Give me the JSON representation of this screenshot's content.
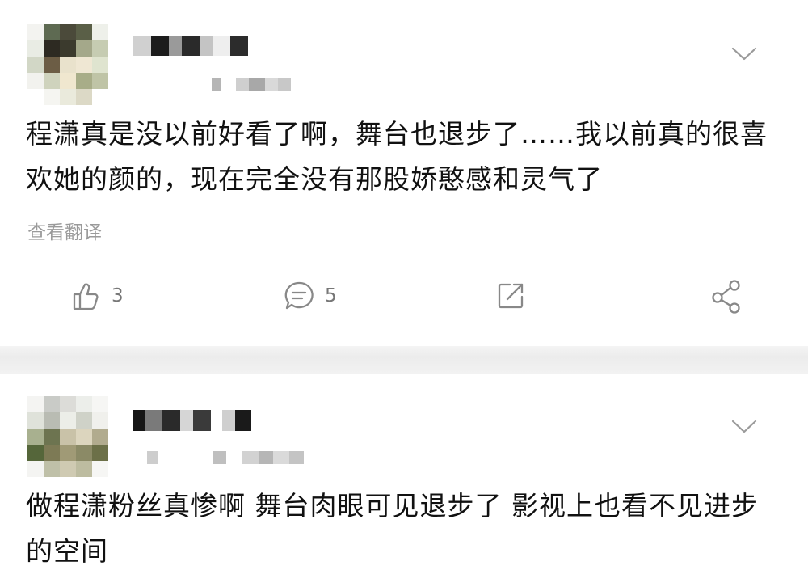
{
  "comments": [
    {
      "text": "程潇真是没以前好看了啊，舞台也退步了……我以前真的很喜欢她的颜的，现在完全没有那股娇憨感和灵气了",
      "translate_label": "查看翻译",
      "like_count": "3",
      "comment_count": "5"
    },
    {
      "text": "做程潇粉丝真惨啊 舞台肉眼可见退步了 影视上也看不见进步的空间"
    }
  ],
  "icons": {
    "like": "thumbs-up-icon",
    "comment": "comment-bubble-icon",
    "repost": "repost-icon",
    "share": "share-icon",
    "more": "chevron-down-icon"
  },
  "colors": {
    "text": "#111111",
    "muted": "#9a9a9a",
    "icon": "#888888"
  }
}
